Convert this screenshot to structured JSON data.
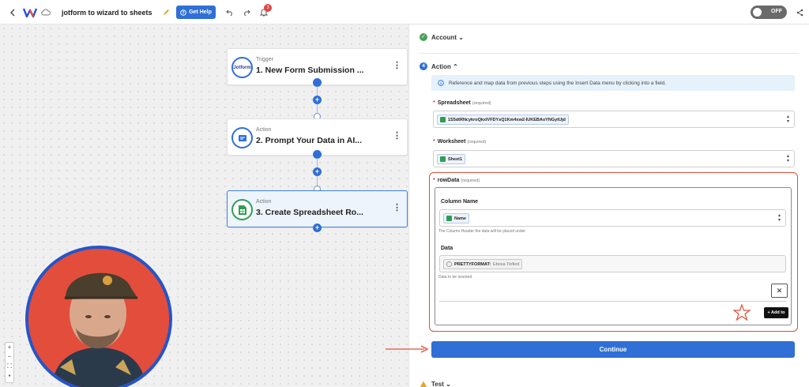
{
  "header": {
    "back_icon": "chevron-left-icon",
    "app_logo": "W",
    "title": "jotform to wizard to sheets",
    "get_help_label": "Get Help",
    "notification_count": "3",
    "toggle_label": "OFF"
  },
  "workflow": {
    "steps": [
      {
        "kind": "Trigger",
        "title": "1. New Form Submission ...",
        "icon_text": "Jotform"
      },
      {
        "kind": "Action",
        "title": "2. Prompt Your Data in AI...",
        "icon_text": ""
      },
      {
        "kind": "Action",
        "title": "3. Create Spreadsheet Ro...",
        "icon_text": ""
      }
    ],
    "menu_glyph": "⋮"
  },
  "panel": {
    "account_label": "Account",
    "action_number": "4",
    "action_label": "Action",
    "info_text": "Reference and map data from previous steps using the Insert Data menu by clicking into a field.",
    "spreadsheet": {
      "label": "Spreadsheet",
      "required": "(required)",
      "value": "1S5dtRNcykroQkxIVFDYsQ1Km4xw2-IUKEBAoYNGytUjd"
    },
    "worksheet": {
      "label": "Worksheet",
      "required": "(required)",
      "value": "Sheet1"
    },
    "rowdata": {
      "label": "rowData",
      "required": "(required)",
      "column_name_label": "Column Name",
      "column_name_value": "Name",
      "column_name_helper": "The Column Header the data will be placed under",
      "data_label": "Data",
      "data_chip_prefix": "PRETTYFORMAT:",
      "data_chip_value": "Ebosa Tiofied",
      "data_helper": "Data to be inserted",
      "remove_label": "✕",
      "add_label": "+ Add to"
    },
    "continue_label": "Continue",
    "test_label": "Test"
  },
  "colors": {
    "accent": "#2f6fd6",
    "highlight_frame": "#e0503a",
    "success": "#4aa35a"
  }
}
